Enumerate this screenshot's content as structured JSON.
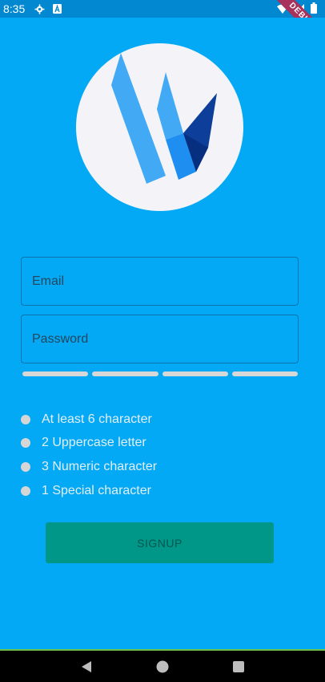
{
  "status_bar": {
    "time": "8:35",
    "icons": [
      "gear-icon",
      "a-icon",
      "wifi-icon",
      "signal-icon",
      "battery-icon"
    ],
    "debug_label": "DEBUG"
  },
  "form": {
    "email_placeholder": "Email",
    "password_placeholder": "Password",
    "strength_segments": 4
  },
  "rules": [
    {
      "label": "At least 6 character"
    },
    {
      "label": "2 Uppercase letter"
    },
    {
      "label": "3 Numeric character"
    },
    {
      "label": "1 Special character"
    }
  ],
  "signup": {
    "label": "SIGNUP"
  },
  "nav": [
    "back-icon",
    "home-icon",
    "recents-icon"
  ],
  "colors": {
    "background": "#03a9f4",
    "button": "#009688",
    "logo_light": "#42aaf5",
    "logo_dark": "#0d3f9a"
  }
}
